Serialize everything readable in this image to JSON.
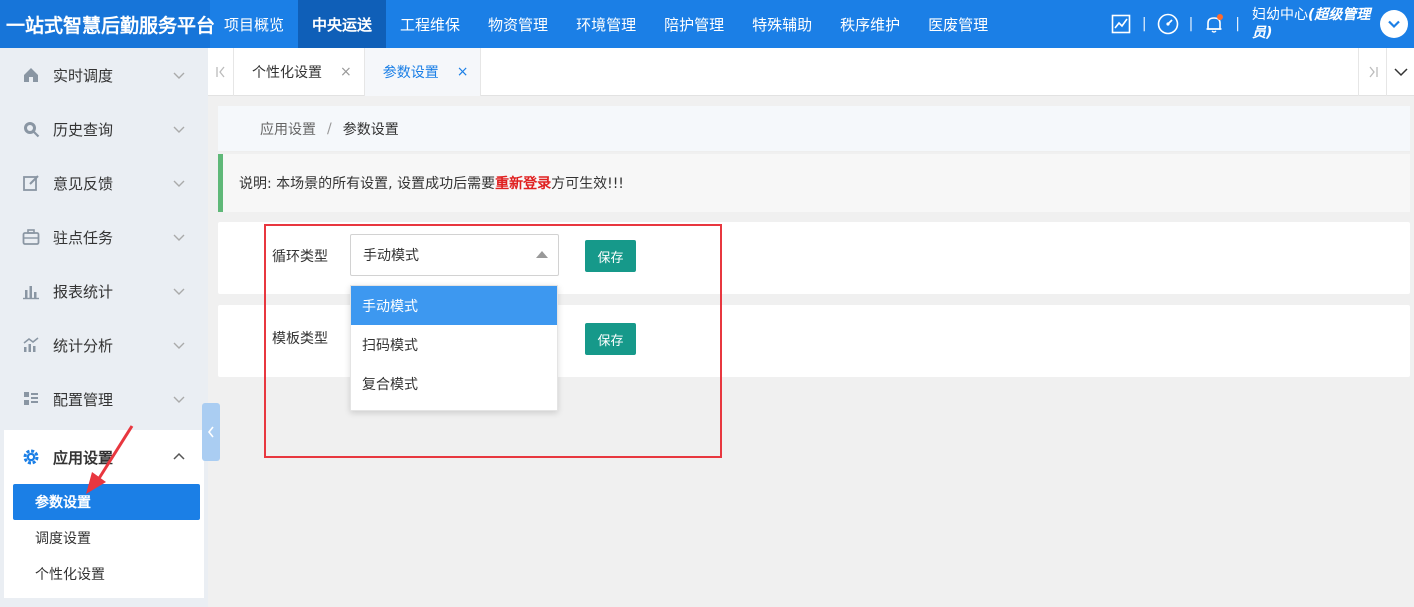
{
  "app": {
    "brand": "一站式智慧后勤服务平台",
    "nav": [
      {
        "label": "项目概览",
        "active": false
      },
      {
        "label": "中央运送",
        "active": true
      },
      {
        "label": "工程维保",
        "active": false
      },
      {
        "label": "物资管理",
        "active": false
      },
      {
        "label": "环境管理",
        "active": false
      },
      {
        "label": "陪护管理",
        "active": false
      },
      {
        "label": "特殊辅助",
        "active": false
      },
      {
        "label": "秩序维护",
        "active": false
      },
      {
        "label": "医废管理",
        "active": false
      }
    ],
    "separator": "|",
    "user": {
      "name": "妇幼中心",
      "role": "(超级管理员)"
    },
    "icons": {
      "stats": "chart-trend-icon",
      "dashboard": "gauge-icon",
      "notifications": "bell-icon",
      "user_menu": "chevron-down-icon"
    },
    "colors": {
      "primary": "#1b7fe6",
      "save_button": "#16998a",
      "notice_bar": "#5fb878",
      "highlight": "#e02020",
      "annotation": "#e8373f"
    }
  },
  "sidebar": {
    "items": [
      {
        "label": "实时调度",
        "icon": "home-icon"
      },
      {
        "label": "历史查询",
        "icon": "search-icon"
      },
      {
        "label": "意见反馈",
        "icon": "edit-icon"
      },
      {
        "label": "驻点任务",
        "icon": "briefcase-icon"
      },
      {
        "label": "报表统计",
        "icon": "bar-chart-icon"
      },
      {
        "label": "统计分析",
        "icon": "analytics-icon"
      },
      {
        "label": "配置管理",
        "icon": "grid-list-icon"
      }
    ],
    "expanded": {
      "label": "应用设置",
      "icon": "gear-icon",
      "children": [
        {
          "label": "参数设置",
          "active": true
        },
        {
          "label": "调度设置",
          "active": false
        },
        {
          "label": "个性化设置",
          "active": false
        }
      ]
    }
  },
  "tabs": {
    "items": [
      {
        "label": "个性化设置",
        "close": "×",
        "active": false
      },
      {
        "label": "参数设置",
        "close": "×",
        "active": true
      }
    ]
  },
  "breadcrumb": {
    "parent": "应用设置",
    "separator": "/",
    "current": "参数设置"
  },
  "notice": {
    "prefix": "说明: 本场景的所有设置, 设置成功后需要",
    "highlight": "重新登录",
    "suffix": "方可生效!!!"
  },
  "form": {
    "cycle_type": {
      "label": "循环类型",
      "value": "手动模式",
      "save": "保存"
    },
    "template_type": {
      "label": "模板类型",
      "save": "保存"
    },
    "dropdown_options": [
      {
        "label": "手动模式",
        "selected": true
      },
      {
        "label": "扫码模式",
        "selected": false
      },
      {
        "label": "复合模式",
        "selected": false
      }
    ]
  }
}
